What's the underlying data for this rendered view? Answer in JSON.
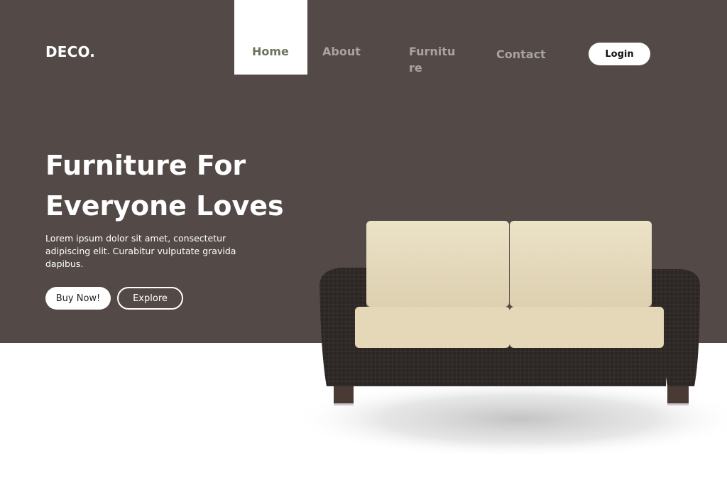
{
  "header": {
    "logo": "DECO.",
    "nav": [
      {
        "label": "Home",
        "active": true
      },
      {
        "label": "About",
        "active": false
      },
      {
        "label": "Furniture",
        "active": false
      },
      {
        "label": "Contact",
        "active": false
      }
    ],
    "login_label": "Login"
  },
  "hero": {
    "title": "Furniture For Everyone Loves",
    "description": "Lorem ipsum dolor sit amet, consectetur adipiscing elit. Curabitur vulputate gravida dapibus.",
    "buy_label": "Buy Now!",
    "explore_label": "Explore"
  },
  "colors": {
    "hero_background": "#534a47",
    "active_nav_text": "#6b745c",
    "inactive_nav_text": "#a8a39f",
    "sofa_cushion": "#e8dcc0",
    "sofa_frame": "#2b2523"
  },
  "images": {
    "hero_product": "sofa-image"
  }
}
